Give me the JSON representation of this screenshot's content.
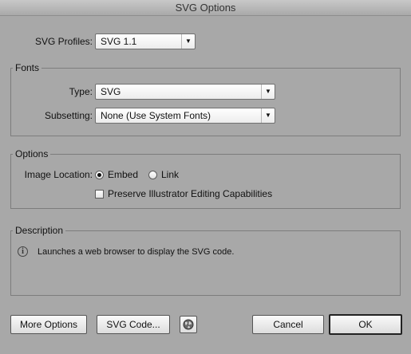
{
  "window": {
    "title": "SVG Options"
  },
  "profiles": {
    "label": "SVG Profiles:",
    "value": "SVG 1.1"
  },
  "fonts": {
    "legend": "Fonts",
    "type_label": "Type:",
    "type_value": "SVG",
    "subsetting_label": "Subsetting:",
    "subsetting_value": "None (Use System Fonts)"
  },
  "options": {
    "legend": "Options",
    "image_location_label": "Image Location:",
    "embed_label": "Embed",
    "link_label": "Link",
    "embed_selected": true,
    "preserve_label": "Preserve Illustrator Editing Capabilities",
    "preserve_checked": false
  },
  "description": {
    "legend": "Description",
    "text": "Launches a web browser to display the SVG code."
  },
  "buttons": {
    "more_options": "More Options",
    "svg_code": "SVG Code...",
    "cancel": "Cancel",
    "ok": "OK"
  }
}
